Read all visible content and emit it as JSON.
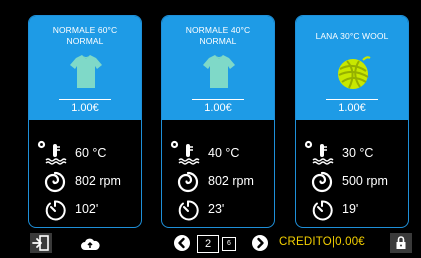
{
  "programs": [
    {
      "name": "NORMALE 60°C\nNORMAL",
      "price": "1.00€",
      "icon": "shirt-icon",
      "temperature": "60 °C",
      "spin": "802 rpm",
      "duration": "102'"
    },
    {
      "name": "NORMALE 40°C\nNORMAL",
      "price": "1.00€",
      "icon": "shirt-icon",
      "temperature": "40 °C",
      "spin": "802 rpm",
      "duration": "23'"
    },
    {
      "name": "LANA 30°C WOOL",
      "price": "1.00€",
      "icon": "wool-ball-icon",
      "temperature": "30 °C",
      "spin": "500 rpm",
      "duration": "19'"
    }
  ],
  "footer": {
    "page_current": "2",
    "page_total": "6",
    "credit_label": "CREDITO|0.00€"
  },
  "colors": {
    "accent": "#1e9be6",
    "border": "#1e8fd8",
    "credit": "#f4d000",
    "shirt": "#7fd9c8",
    "wool": "#c8e800"
  }
}
